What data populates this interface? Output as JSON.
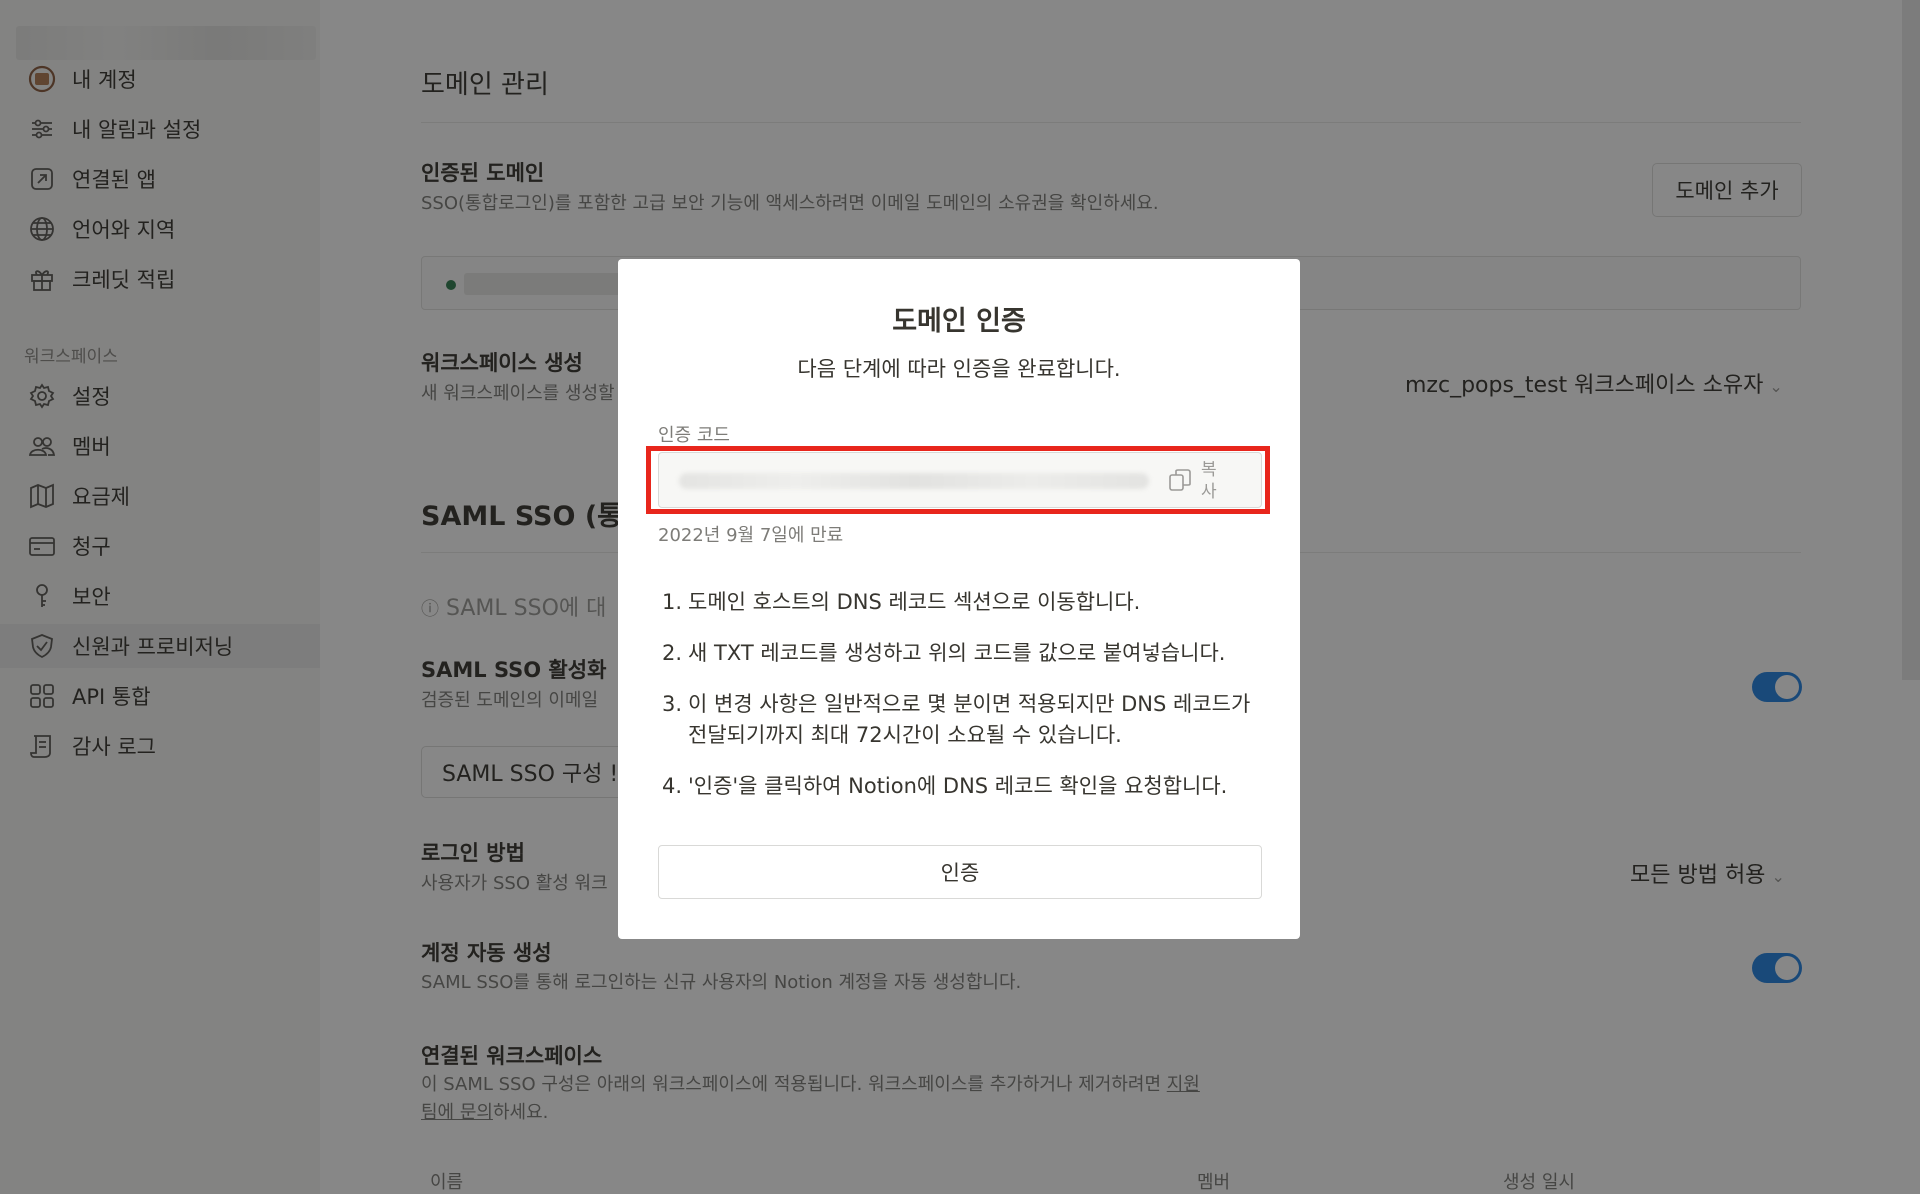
{
  "sidebar": {
    "account_items": [
      {
        "label": "내 계정",
        "icon": "avatar-icon"
      },
      {
        "label": "내 알림과 설정",
        "icon": "sliders-icon"
      },
      {
        "label": "연결된 앱",
        "icon": "external-link-icon"
      },
      {
        "label": "언어와 지역",
        "icon": "globe-icon"
      },
      {
        "label": "크레딧 적립",
        "icon": "gift-icon"
      }
    ],
    "workspace_section": "워크스페이스",
    "workspace_items": [
      {
        "label": "설정",
        "icon": "gear-icon"
      },
      {
        "label": "멤버",
        "icon": "people-icon"
      },
      {
        "label": "요금제",
        "icon": "map-icon"
      },
      {
        "label": "청구",
        "icon": "credit-card-icon"
      },
      {
        "label": "보안",
        "icon": "key-icon"
      },
      {
        "label": "신원과 프로비저닝",
        "icon": "shield-check-icon",
        "active": true
      },
      {
        "label": "API 통합",
        "icon": "grid-icon"
      },
      {
        "label": "감사 로그",
        "icon": "scroll-icon"
      }
    ]
  },
  "main": {
    "title": "도메인 관리",
    "verified_domains": {
      "title": "인증된 도메인",
      "desc": "SSO(통합로그인)를 포함한 고급 보안 기능에 액세스하려면 이메일 도메인의 소유권을 확인하세요.",
      "add_button": "도메인 추가"
    },
    "workspace_creation": {
      "title": "워크스페이스 생성",
      "desc": "새 워크스페이스를 생성할",
      "select": "mzc_pops_test 워크스페이스 소유자"
    },
    "saml_title": "SAML SSO (통합",
    "saml_hint": "SAML SSO에 대",
    "saml_enable": {
      "title": "SAML SSO 활성화",
      "desc": "검증된 도메인의 이메일"
    },
    "saml_config_button": "SAML SSO 구성 !",
    "login_method": {
      "title": "로그인 방법",
      "desc": "사용자가 SSO 활성 워크",
      "select": "모든 방법 허용"
    },
    "auto_account": {
      "title": "계정 자동 생성",
      "desc": "SAML SSO를 통해 로그인하는 신규 사용자의 Notion 계정을 자동 생성합니다."
    },
    "linked_workspaces": {
      "title": "연결된 워크스페이스",
      "desc_1": "이 SAML SSO 구성은 아래의 워크스페이스에 적용됩니다. 워크스페이스를 추가하거나 제거하려면 ",
      "link_1": "지원",
      "link_2": "팀에 문의",
      "desc_2": "하세요."
    },
    "table_headers": [
      "이름",
      "멤버",
      "생성 일시"
    ]
  },
  "dialog": {
    "title": "도메인 인증",
    "subtitle": "다음 단계에 따라 인증을 완료합니다.",
    "code_label": "인증 코드",
    "copy_label": "복사",
    "expiry": "2022년 9월 7일에 만료",
    "steps": [
      {
        "num": "1.",
        "text": "도메인 호스트의 DNS 레코드 섹션으로 이동합니다."
      },
      {
        "num": "2.",
        "text": "새 TXT 레코드를 생성하고 위의 코드를 값으로 붙여넣습니다."
      },
      {
        "num": "3.",
        "text": "이 변경 사항은 일반적으로 몇 분이면 적용되지만 DNS 레코드가 전달되기까지 최대 72시간이 소요될 수 있습니다."
      },
      {
        "num": "4.",
        "text": "'인증'을 클릭하여 Notion에 DNS 레코드 확인을 요청합니다."
      }
    ],
    "verify_button": "인증"
  },
  "colors": {
    "toggle_on": "#2383e2",
    "highlight": "#e8261c",
    "verified_dot": "#2f7d4f"
  }
}
